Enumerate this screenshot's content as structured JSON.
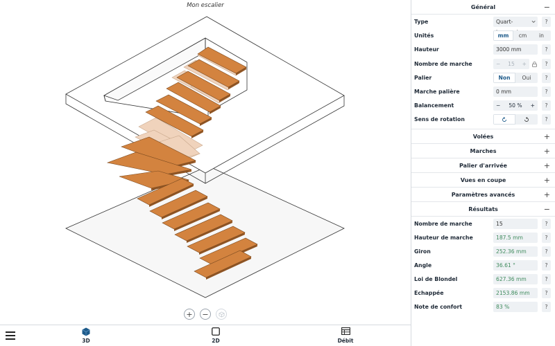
{
  "viewport": {
    "title": "Mon escalier",
    "zoom_in": "+",
    "zoom_out": "−"
  },
  "nav": {
    "tabs": [
      {
        "label": "3D",
        "icon": "cube-icon"
      },
      {
        "label": "2D",
        "icon": "square-icon"
      },
      {
        "label": "Débit",
        "icon": "table-icon"
      }
    ]
  },
  "colors": {
    "tread": "#d3833f",
    "tread_edge": "#7a4a20",
    "tread_ghost": "#f0d3bc",
    "accent": "#1d5a8a",
    "result_value": "#3e8a5c"
  },
  "general": {
    "title": "Général",
    "toggle": "−",
    "type_label": "Type",
    "type_value": "Quart-tournant",
    "units_label": "Unités",
    "units_options": [
      "mm",
      "cm",
      "in"
    ],
    "units_selected": "mm",
    "height_label": "Hauteur",
    "height_value": "3000 mm",
    "steps_label": "Nombre de marche",
    "steps_value": "15",
    "steps_minus": "−",
    "steps_plus": "+",
    "landing_label": "Palier",
    "landing_options": [
      "Non",
      "Oui"
    ],
    "landing_selected": "Non",
    "landing_step_label": "Marche palière",
    "landing_step_value": "0 mm",
    "balance_label": "Balancement",
    "balance_value": "50 %",
    "balance_minus": "−",
    "balance_plus": "+",
    "rotation_label": "Sens de rotation",
    "help": "?"
  },
  "sections": [
    {
      "title": "Volées",
      "toggle": "+"
    },
    {
      "title": "Marches",
      "toggle": "+"
    },
    {
      "title": "Palier d'arrivée",
      "toggle": "+"
    },
    {
      "title": "Vues en coupe",
      "toggle": "+"
    },
    {
      "title": "Paramètres avancés",
      "toggle": "+"
    }
  ],
  "results": {
    "title": "Résultats",
    "toggle": "−",
    "rows": [
      {
        "label": "Nombre de marche",
        "value": "15",
        "green": false
      },
      {
        "label": "Hauteur de marche",
        "value": "187.5 mm",
        "green": true
      },
      {
        "label": "Giron",
        "value": "252.36 mm",
        "green": true
      },
      {
        "label": "Angle",
        "value": "36.61 °",
        "green": true
      },
      {
        "label": "Loi de Blondel",
        "value": "627.36 mm",
        "green": true
      },
      {
        "label": "Echappée",
        "value": "2153.86 mm",
        "green": true
      },
      {
        "label": "Note de confort",
        "value": "83 %",
        "green": true
      }
    ]
  }
}
